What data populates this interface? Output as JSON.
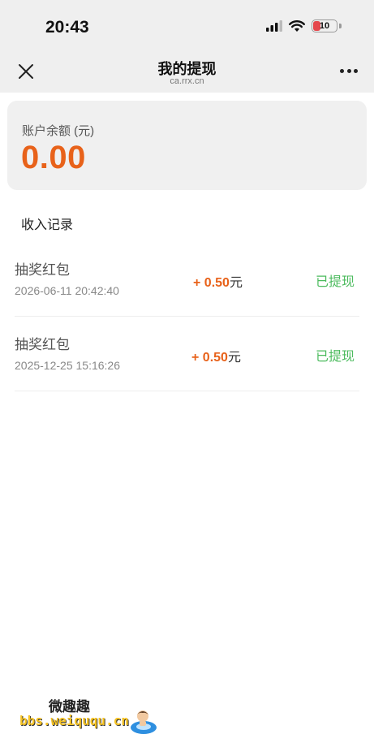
{
  "status_bar": {
    "time": "20:43",
    "battery": "10"
  },
  "nav": {
    "title": "我的提现",
    "subtitle": "ca.rrx.cn"
  },
  "balance": {
    "label": "账户余额 (元)",
    "value": "0.00"
  },
  "records_section": {
    "title": "收入记录"
  },
  "records": [
    {
      "title": "抽奖红包",
      "time": "2026-06-11 20:42:40",
      "amount": "+ 0.50",
      "unit": "元",
      "status": "已提现"
    },
    {
      "title": "抽奖红包",
      "time": "2025-12-25 15:16:26",
      "amount": "+ 0.50",
      "unit": "元",
      "status": "已提现"
    }
  ],
  "watermark": {
    "title": "微趣趣",
    "url": "bbs.weiququ.cn"
  },
  "colors": {
    "accent": "#e8621a",
    "success": "#4cbb5e",
    "header_bg": "#efefef"
  }
}
